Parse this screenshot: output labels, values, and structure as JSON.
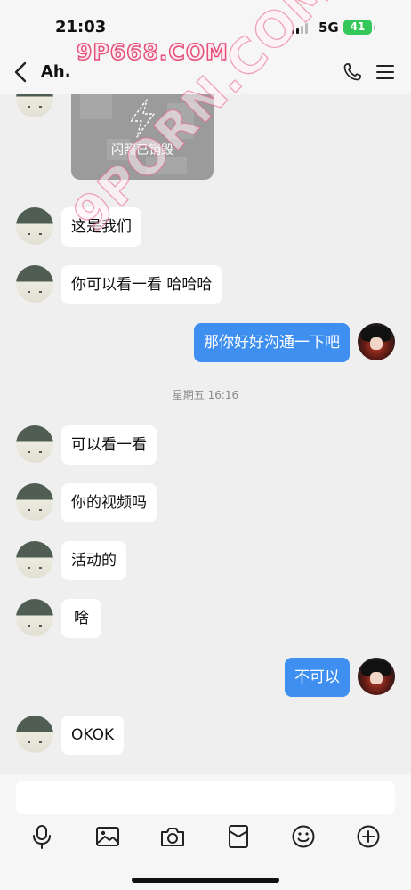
{
  "status_bar": {
    "time": "21:03",
    "network": "5G",
    "battery": "41"
  },
  "header": {
    "title": "Ah.",
    "back_icon": "chevron-left-icon",
    "call_icon": "phone-icon",
    "menu_icon": "menu-icon"
  },
  "watermarks": {
    "top": "9P668.COM",
    "diagonal": "9PORN.COM"
  },
  "media_message": {
    "label": "闪照已销毁",
    "icon": "flash-photo-icon"
  },
  "messages": [
    {
      "sender": "other",
      "text": "这是我们"
    },
    {
      "sender": "other",
      "text": "你可以看一看 哈哈哈"
    },
    {
      "sender": "self",
      "text": "那你好好沟通一下吧"
    },
    {
      "sender": "other",
      "text": "可以看一看"
    },
    {
      "sender": "other",
      "text": "你的视频吗"
    },
    {
      "sender": "other",
      "text": "活动的"
    },
    {
      "sender": "other",
      "text": "啥"
    },
    {
      "sender": "self",
      "text": "不可以"
    },
    {
      "sender": "other",
      "text": "OKOK"
    }
  ],
  "timestamp": "星期五 16:16",
  "input": {
    "value": "",
    "placeholder": ""
  },
  "toolbar": {
    "icons": [
      "microphone-icon",
      "image-icon",
      "camera-icon",
      "red-packet-icon",
      "emoji-icon",
      "add-icon"
    ]
  },
  "colors": {
    "background": "#efefef",
    "outgoing_bubble": "#3e8ff0",
    "incoming_bubble": "#ffffff",
    "battery": "#34c759",
    "watermark": "#e44f7a"
  }
}
